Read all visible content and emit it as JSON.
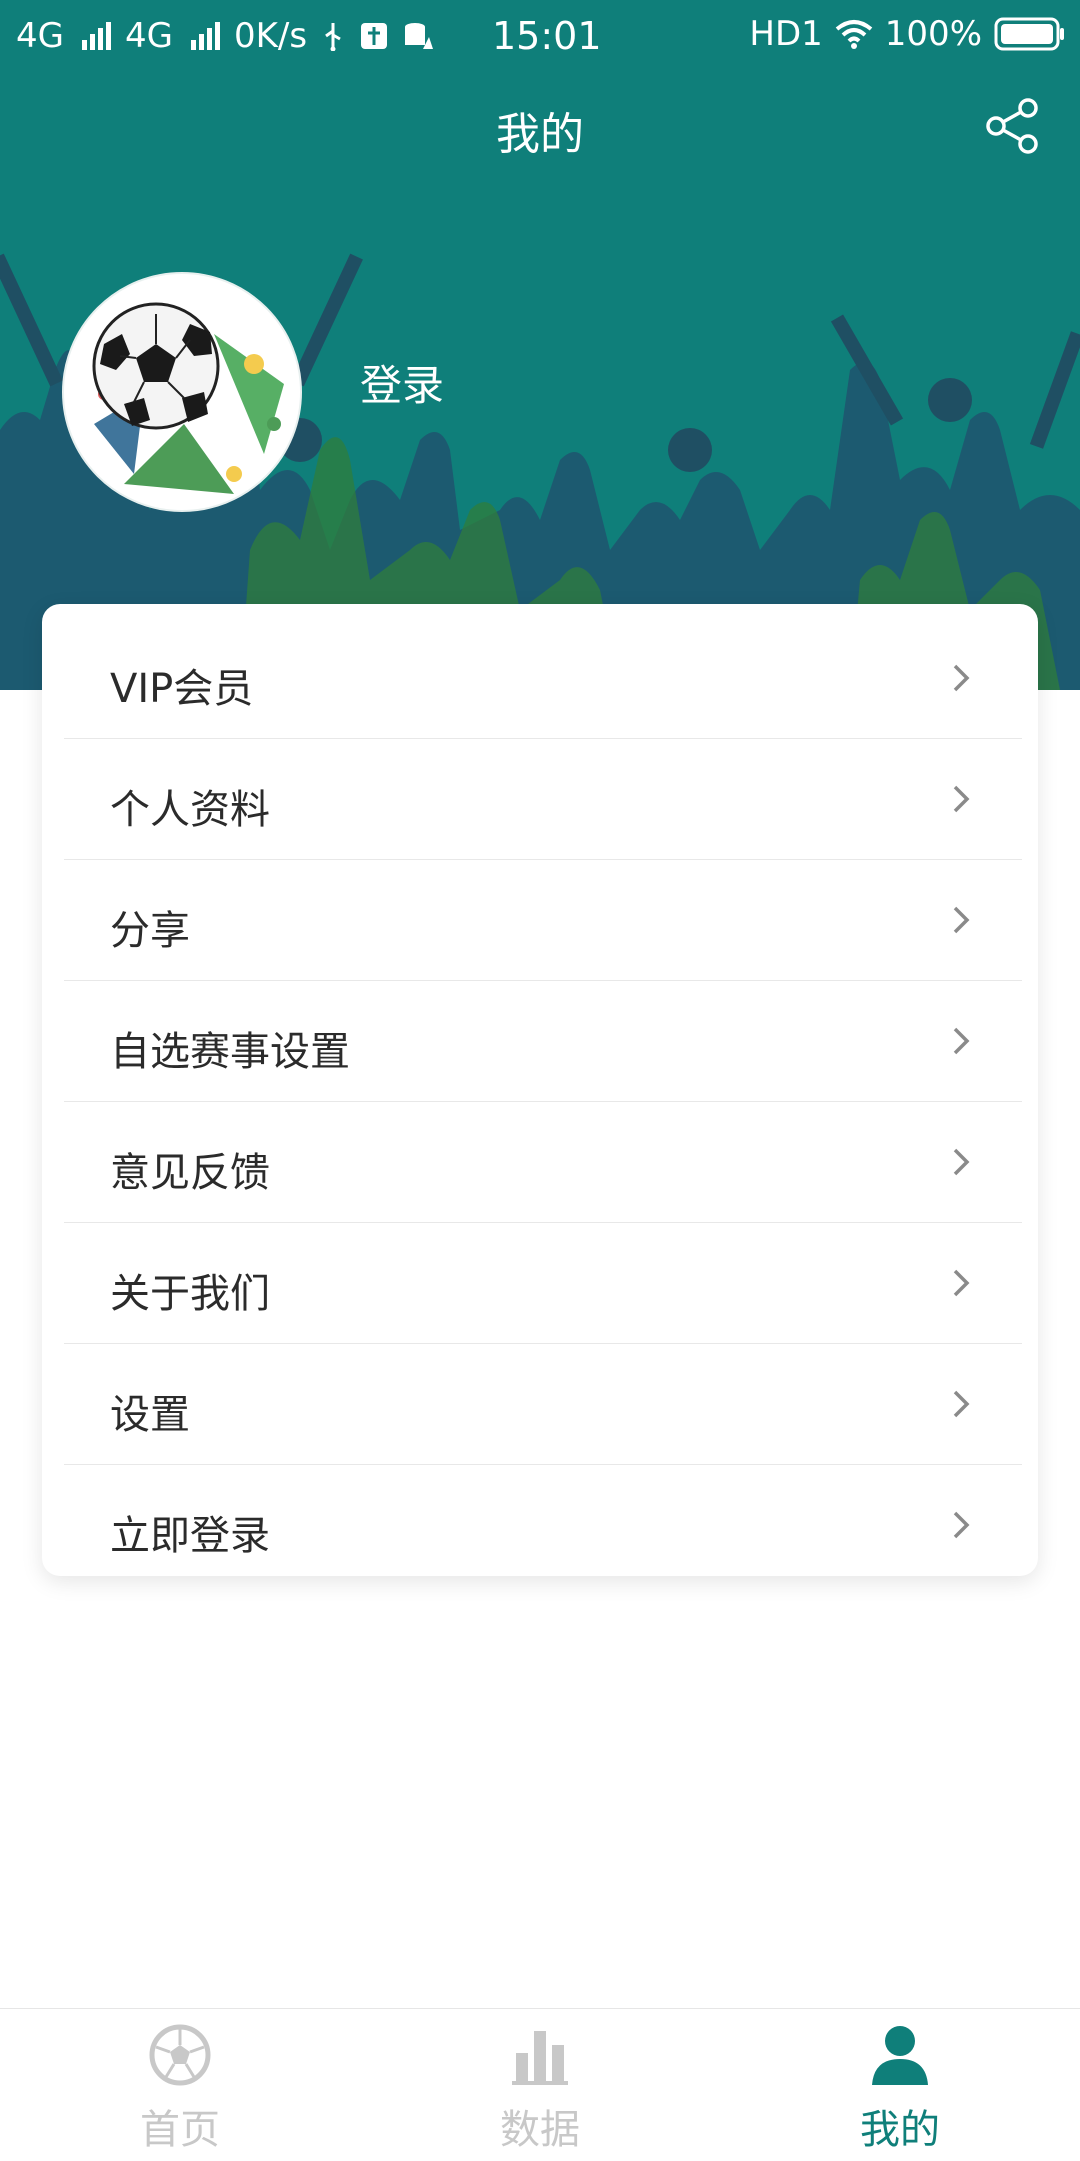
{
  "status_bar": {
    "network1": "4G",
    "network2": "4G",
    "speed": "0K/s",
    "time": "15:01",
    "hd": "HD1",
    "battery": "100%"
  },
  "header": {
    "title": "我的",
    "login_text": "登录",
    "share_icon": "share-icon",
    "avatar_icon": "soccer-ball-icon",
    "background_color": "#0f7f7a"
  },
  "menu": {
    "items": [
      {
        "label": "VIP会员"
      },
      {
        "label": "个人资料"
      },
      {
        "label": "分享"
      },
      {
        "label": "自选赛事设置"
      },
      {
        "label": "意见反馈"
      },
      {
        "label": "关于我们"
      },
      {
        "label": "设置"
      },
      {
        "label": "立即登录"
      }
    ]
  },
  "bottom_nav": {
    "tabs": [
      {
        "label": "首页",
        "icon": "soccer-ball-icon",
        "active": false
      },
      {
        "label": "数据",
        "icon": "bar-chart-icon",
        "active": false
      },
      {
        "label": "我的",
        "icon": "person-icon",
        "active": true
      }
    ],
    "active_color": "#0f7f7a",
    "inactive_color": "#c8c8c8"
  }
}
